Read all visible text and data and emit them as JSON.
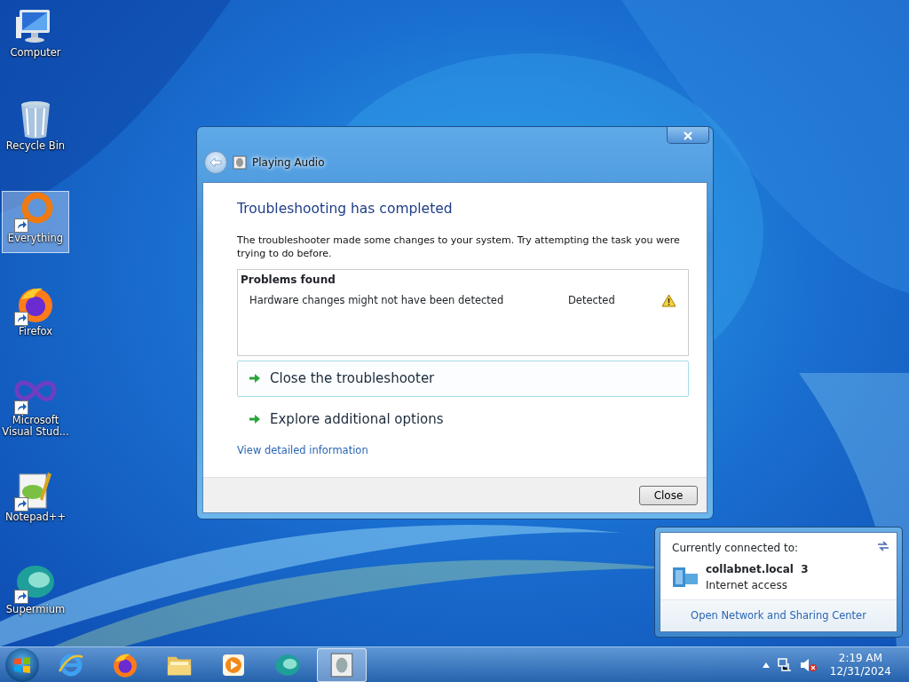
{
  "desktop_icons": [
    {
      "kind": "computer",
      "label": "Computer",
      "selected": false,
      "shortcut": false
    },
    {
      "kind": "recycle-bin",
      "label": "Recycle Bin",
      "selected": false,
      "shortcut": false
    },
    {
      "kind": "ring",
      "label": "Everything",
      "selected": true,
      "shortcut": true
    },
    {
      "kind": "fox",
      "label": "Firefox",
      "selected": false,
      "shortcut": true
    },
    {
      "kind": "infinity",
      "label": "Microsoft Visual Stud...",
      "selected": false,
      "shortcut": true
    },
    {
      "kind": "notepad",
      "label": "Notepad++",
      "selected": false,
      "shortcut": true
    },
    {
      "kind": "sphere",
      "label": "Supermium",
      "selected": false,
      "shortcut": true
    }
  ],
  "dialog": {
    "title": "Playing Audio",
    "heading": "Troubleshooting has completed",
    "description": "The troubleshooter made some changes to your system. Try attempting the task you were trying to do before.",
    "problems": {
      "heading": "Problems found",
      "items": [
        {
          "text": "Hardware changes might not have been detected",
          "status": "Detected"
        }
      ]
    },
    "options": [
      {
        "label": "Close the troubleshooter",
        "selected": true
      },
      {
        "label": "Explore additional options",
        "selected": false
      }
    ],
    "link": "View detailed information",
    "buttons": [
      "Close"
    ]
  },
  "network_popup": {
    "heading": "Currently connected to:",
    "network": "collabnet.local  3",
    "access": "Internet access",
    "link": "Open Network and Sharing Center"
  },
  "taskbar": {
    "items": [
      {
        "kind": "browser-e",
        "selected": false
      },
      {
        "kind": "fox",
        "selected": false
      },
      {
        "kind": "folder",
        "selected": false
      },
      {
        "kind": "media",
        "selected": false
      },
      {
        "kind": "sphere",
        "selected": false
      },
      {
        "kind": "troubleshooter",
        "selected": true
      }
    ],
    "time": "2:19 AM",
    "date": "12/31/2024"
  }
}
